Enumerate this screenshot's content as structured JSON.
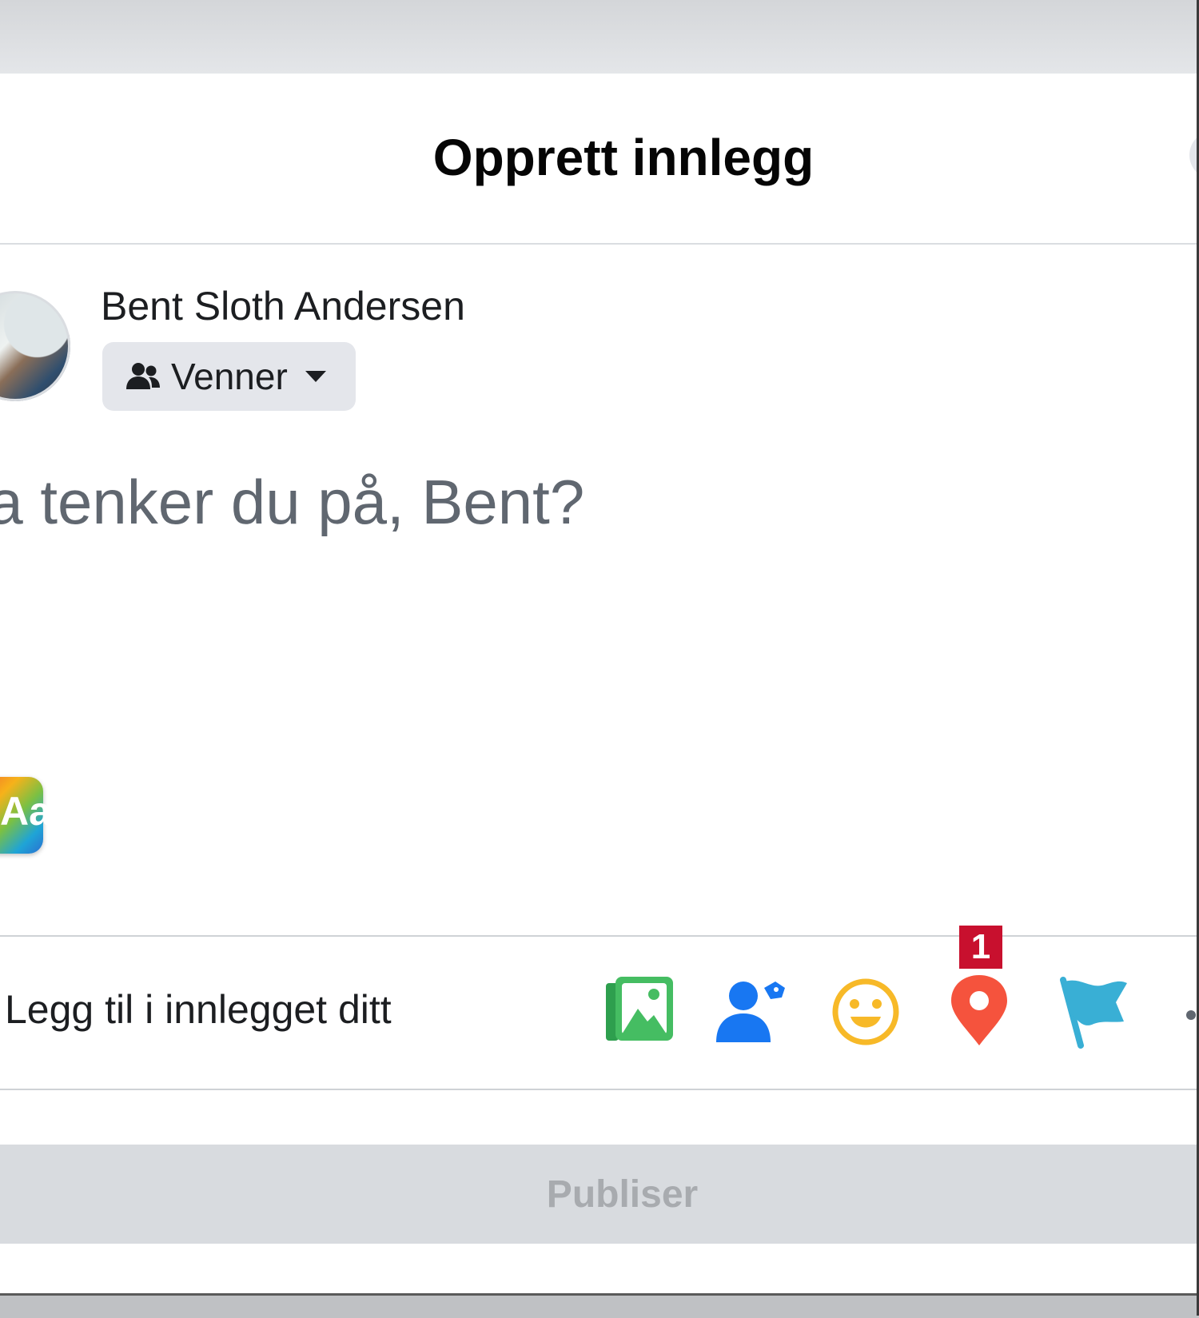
{
  "dialog": {
    "title": "Opprett innlegg"
  },
  "author": {
    "name": "Bent Sloth Andersen",
    "audience_label": "Venner"
  },
  "composer": {
    "placeholder": "Hva tenker du på, Bent?"
  },
  "background_picker": {
    "letter": "Aa"
  },
  "add_to_post": {
    "label": "Legg til i innlegget ditt",
    "tools": [
      {
        "icon": "photo-video-icon",
        "color": "#45bd62"
      },
      {
        "icon": "tag-people-icon",
        "color": "#1877f2"
      },
      {
        "icon": "feeling-activity-icon",
        "color": "#f7b928"
      },
      {
        "icon": "check-in-icon",
        "color": "#f5533d"
      },
      {
        "icon": "life-event-flag-icon",
        "color": "#39afd5"
      },
      {
        "icon": "more-options-icon",
        "color": "#606770"
      }
    ]
  },
  "annotation": {
    "step_number": "1",
    "color": "#c8102e"
  },
  "footer": {
    "publish_label": "Publiser"
  }
}
